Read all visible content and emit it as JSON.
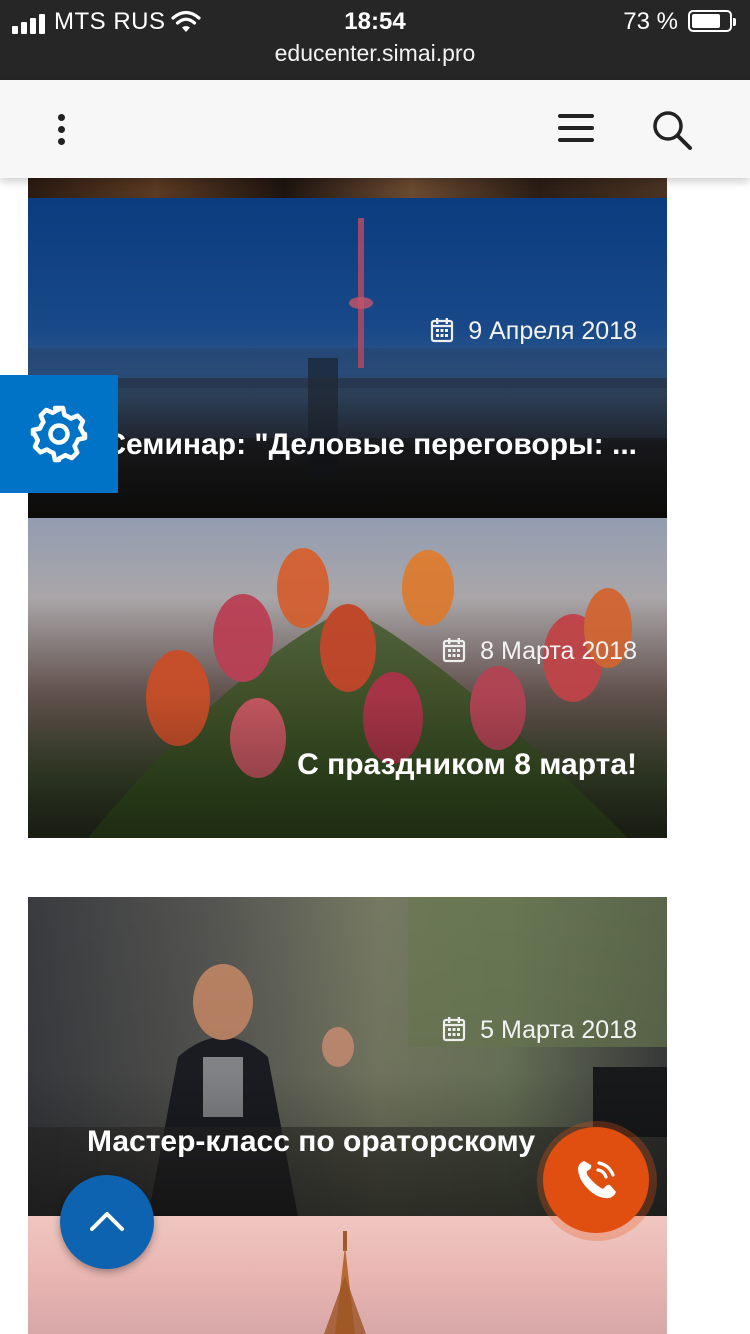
{
  "status_bar": {
    "carrier": "MTS RUS",
    "time": "18:54",
    "battery": "73 %",
    "battery_level": 0.73,
    "url": "educenter.simai.pro"
  },
  "header": {
    "icons": [
      "kebab-menu-icon",
      "hamburger-menu-icon",
      "search-icon"
    ]
  },
  "cards": [
    {
      "date": "9 Апреля 2018",
      "title": "Семинар: \"Деловые переговоры: ...",
      "image": "handshake-city-skyline"
    },
    {
      "date": "8 Марта 2018",
      "title": "С праздником 8 марта!",
      "image": "tulips-bouquet"
    },
    {
      "date": "5 Марта 2018",
      "title": "Мастер-класс по ораторскому",
      "image": "speaker-presentation"
    },
    {
      "image": "eiffel-tower-pink-sky"
    }
  ],
  "floating": {
    "settings_icon": "gear-icon",
    "scroll_top_icon": "chevron-up-icon",
    "call_icon": "phone-call-icon",
    "accent_blue": "#0073c7",
    "accent_orange": "#e04e10"
  }
}
